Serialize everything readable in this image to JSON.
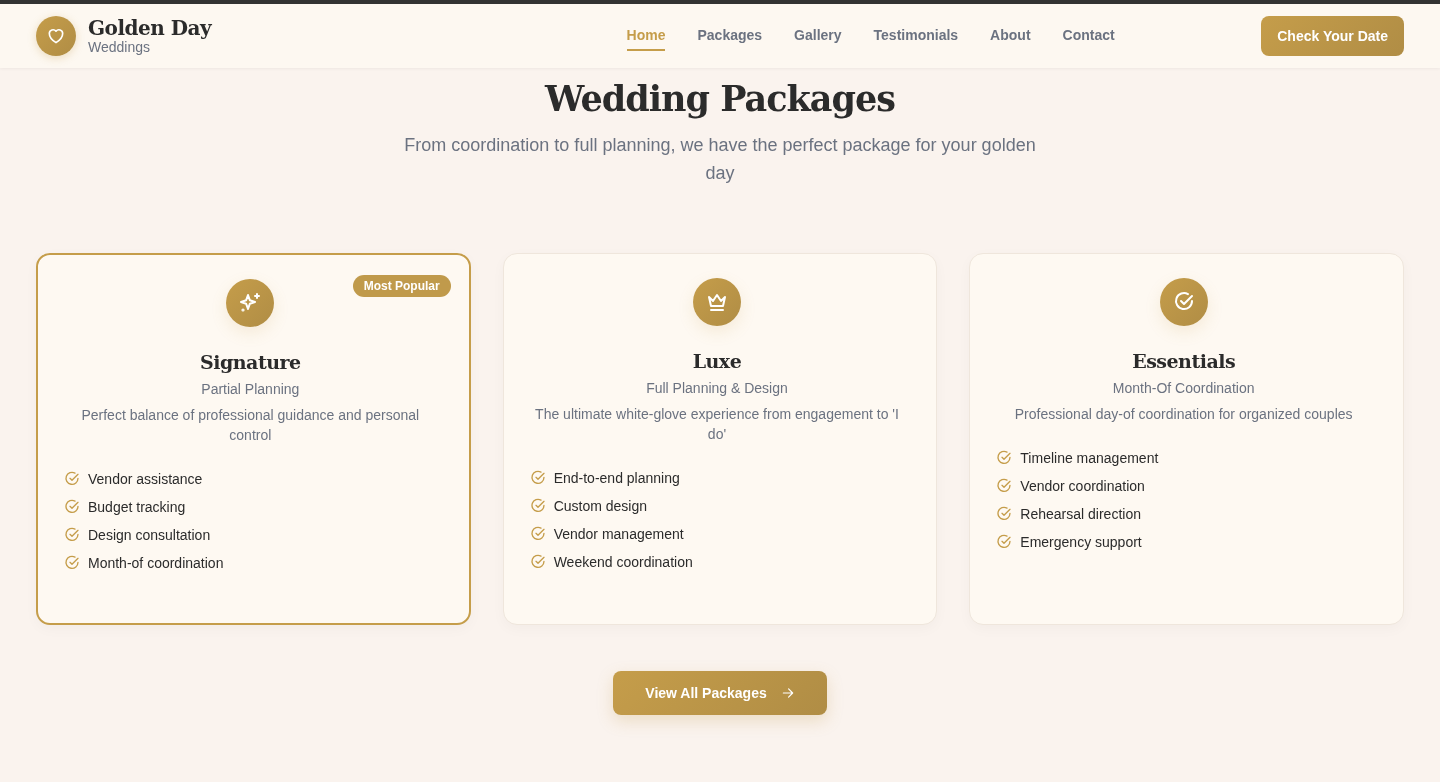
{
  "header": {
    "brand": {
      "name": "Golden Day",
      "tagline": "Weddings"
    },
    "nav": [
      {
        "label": "Home",
        "selected": true
      },
      {
        "label": "Packages",
        "selected": false
      },
      {
        "label": "Gallery",
        "selected": false
      },
      {
        "label": "Testimonials",
        "selected": false
      },
      {
        "label": "About",
        "selected": false
      },
      {
        "label": "Contact",
        "selected": false
      }
    ],
    "cta": "Check Your Date"
  },
  "section": {
    "title": "Wedding Packages",
    "subtitle": "From coordination to full planning, we have the perfect package for your golden day"
  },
  "packages": [
    {
      "name": "Signature",
      "subtitle": "Partial Planning",
      "description": "Perfect balance of professional guidance and personal control",
      "featured": true,
      "badge": "Most Popular",
      "features": [
        "Vendor assistance",
        "Budget tracking",
        "Design consultation",
        "Month-of coordination"
      ]
    },
    {
      "name": "Luxe",
      "subtitle": "Full Planning & Design",
      "description": "The ultimate white-glove experience from engagement to 'I do'",
      "featured": false,
      "features": [
        "End-to-end planning",
        "Custom design",
        "Vendor management",
        "Weekend coordination"
      ]
    },
    {
      "name": "Essentials",
      "subtitle": "Month-Of Coordination",
      "description": "Professional day-of coordination for organized couples",
      "featured": false,
      "features": [
        "Timeline management",
        "Vendor coordination",
        "Rehearsal direction",
        "Emergency support"
      ]
    }
  ],
  "view_all_button": "View All Packages"
}
